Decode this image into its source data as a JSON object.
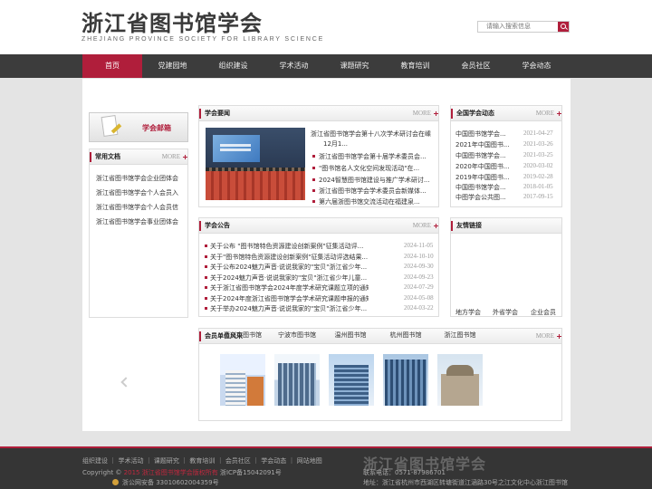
{
  "header": {
    "logo_cn": "浙江省图书馆学会",
    "logo_en": "ZHEJIANG PROVINCE SOCIETY FOR LIBRARY SCIENCE",
    "search_placeholder": "请输入搜索信息"
  },
  "nav": [
    {
      "label": "首页",
      "active": true
    },
    {
      "label": "党建园地"
    },
    {
      "label": "组织建设"
    },
    {
      "label": "学术活动"
    },
    {
      "label": "课题研究"
    },
    {
      "label": "教育培训"
    },
    {
      "label": "会员社区"
    },
    {
      "label": "学会动态"
    }
  ],
  "mailbox": {
    "label": "学会邮箱"
  },
  "docs": {
    "title": "常用文档",
    "more": "MORE",
    "items": [
      "浙江省图书馆学会企业团体会",
      "浙江省图书馆学会个人会员入",
      "浙江省图书馆学会个人会员信",
      "浙江省图书馆学会事业团体会"
    ]
  },
  "news": {
    "title": "学会要闻",
    "more": "MORE",
    "lead": "浙江省图书馆学会第十八次学术研讨会在嵊",
    "lead2": "12月1...",
    "items": [
      "浙江省图书馆学会第十届学术委员会...",
      "\"图书馆名人文化空间发现活动\"在...",
      "2024智慧图书馆建设与推广学术研讨...",
      "浙江省图书馆学会学术委员会新媒体...",
      "第六届浙图书馆交流活动在福建泉..."
    ]
  },
  "dynamics": {
    "title": "全国学会动态",
    "more": "MORE",
    "items": [
      {
        "text": "中国图书馆学会...",
        "date": "2021-04-27"
      },
      {
        "text": "2021年中国图书...",
        "date": "2021-03-26"
      },
      {
        "text": "中国图书馆学会...",
        "date": "2021-03-25"
      },
      {
        "text": "2020年中国图书...",
        "date": "2020-03-02"
      },
      {
        "text": "2019年中国图书...",
        "date": "2019-02-28"
      },
      {
        "text": "中国图书馆学会...",
        "date": "2018-01-05"
      },
      {
        "text": "中图学会公共图...",
        "date": "2017-09-15"
      }
    ]
  },
  "notice": {
    "title": "学会公告",
    "more": "MORE",
    "items": [
      {
        "text": "关于公布 \"图书馆特色资源建设创新案例\"征集活动评...",
        "date": "2024-11-05"
      },
      {
        "text": "关于\"图书馆特色资源建设创新案例\"征集活动评选结果...",
        "date": "2024-10-10"
      },
      {
        "text": "关于公布2024魅力声音·说说我家的\"宝贝\"浙江省少年...",
        "date": "2024-09-30"
      },
      {
        "text": "关于2024魅力声音·说说我家的\"宝贝\"浙江省少年儿童...",
        "date": "2024-09-23"
      },
      {
        "text": "关于浙江省图书馆学会2024年度学术研究课题立项的通知",
        "date": "2024-07-29"
      },
      {
        "text": "关于2024年度浙江省图书馆学会学术研究课题申报的通知",
        "date": "2024-05-08"
      },
      {
        "text": "关于举办2024魅力声音·说说我家的\"宝贝\"浙江省少年...",
        "date": "2024-03-22"
      }
    ]
  },
  "links": {
    "title": "友情链接",
    "items": [
      "地方学会",
      "外省学会",
      "企业会员"
    ]
  },
  "members": {
    "title": "会员单位风采",
    "more": "MORE",
    "items": [
      "嘉兴市图书馆",
      "宁波市图书馆",
      "温州图书馆",
      "杭州图书馆",
      "浙江图书馆"
    ]
  },
  "footer": {
    "links": [
      "组织建设",
      "学术活动",
      "课题研究",
      "教育培训",
      "会员社区",
      "学会动态",
      "网站地图"
    ],
    "copyright": "Copyright ©",
    "owner": "2015 浙江省图书馆学会版权所有",
    "icp": "浙ICP备15042091号",
    "police": "浙公网安备 33010602004359号",
    "logo": "浙江省图书馆学会",
    "phone": "联系电话：0571-87986701",
    "address": "地址：浙江省杭州市西湖区转塘街道江涵路30号之江文化中心浙江图书馆"
  }
}
